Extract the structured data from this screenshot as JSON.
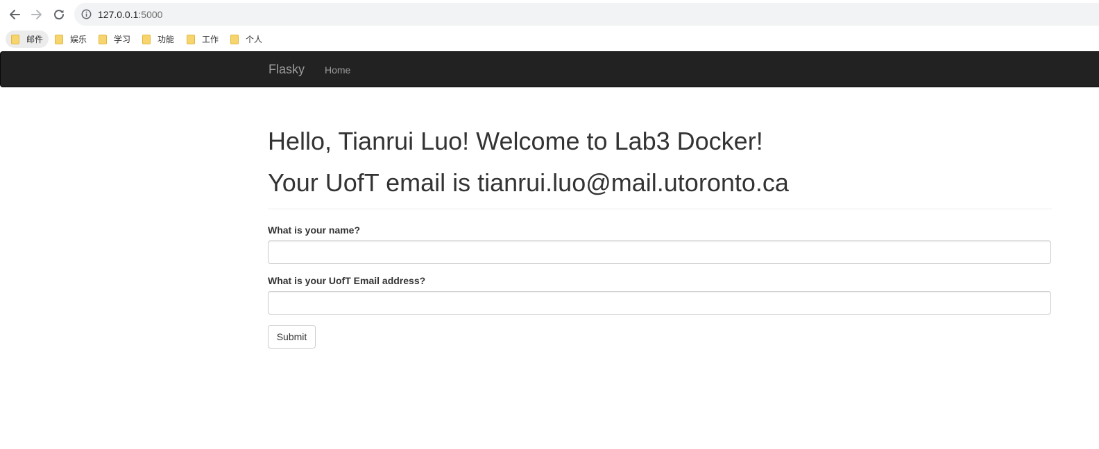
{
  "browser": {
    "address": {
      "host": "127.0.0.1",
      "port": ":5000"
    },
    "icons": {
      "back": "arrow-left-icon",
      "forward": "arrow-right-icon",
      "reload": "reload-icon",
      "info": "info-icon"
    },
    "bookmarks": [
      {
        "label": "邮件",
        "active": true
      },
      {
        "label": "娱乐"
      },
      {
        "label": "学习"
      },
      {
        "label": "功能"
      },
      {
        "label": "工作"
      },
      {
        "label": "个人"
      }
    ]
  },
  "navbar": {
    "brand": "Flasky",
    "links": [
      {
        "label": "Home"
      }
    ],
    "background": "#222222",
    "link_color": "#9d9d9d"
  },
  "main": {
    "greeting": "Hello, Tianrui Luo! Welcome to Lab3 Docker!",
    "email_line": "Your UofT email is tianrui.luo@mail.utoronto.ca",
    "form": {
      "name_label": "What is your name?",
      "name_value": "",
      "email_label": "What is your UofT Email address?",
      "email_value": "",
      "submit_label": "Submit"
    }
  }
}
